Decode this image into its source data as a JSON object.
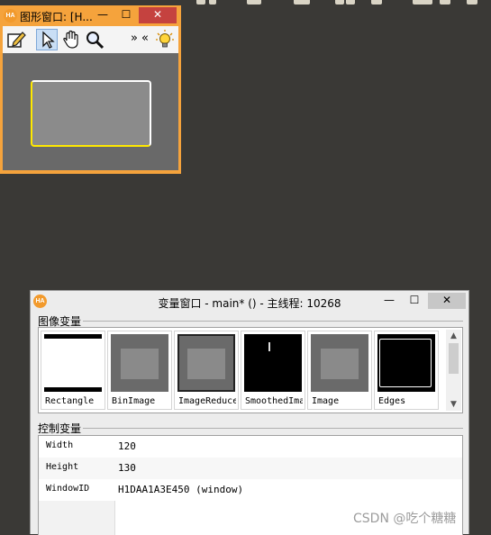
{
  "graphics_window": {
    "title": "图形窗口: [H...",
    "logo": "HA",
    "controls": {
      "minimize": "—",
      "maximize": "☐",
      "close": "✕"
    },
    "toolbar": {
      "more": "»",
      "back": "«"
    }
  },
  "variable_window": {
    "title": "变量窗口 - main* () - 主线程: 10268",
    "logo": "HA",
    "controls": {
      "minimize": "—",
      "maximize": "☐",
      "close": "✕"
    },
    "iconic_section": "图像变量",
    "control_section": "控制变量",
    "iconic_vars": [
      {
        "name": "Rectangle"
      },
      {
        "name": "BinImage"
      },
      {
        "name": "ImageReduced"
      },
      {
        "name": "SmoothedImage"
      },
      {
        "name": "Image"
      },
      {
        "name": "Edges"
      }
    ],
    "control_vars": [
      {
        "name": "Width",
        "value": "120"
      },
      {
        "name": "Height",
        "value": "130"
      },
      {
        "name": "WindowID",
        "value": "H1DAA1A3E450 (window)"
      }
    ]
  },
  "watermark": "CSDN @吃个糖糖"
}
